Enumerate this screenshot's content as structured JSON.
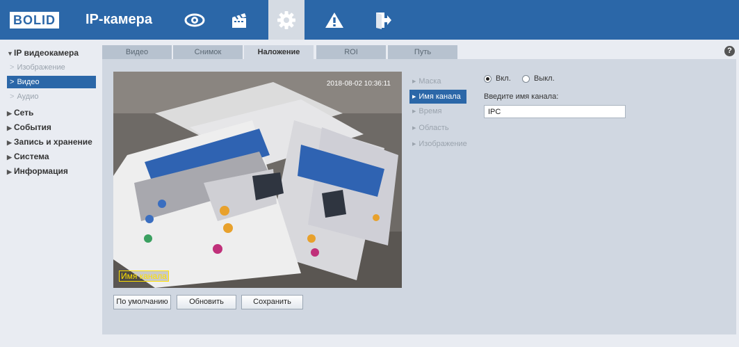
{
  "header": {
    "logo_text": "BOLID",
    "app_title": "IP-камера",
    "nav_icons": [
      "eye-icon",
      "clapperboard-icon",
      "gear-icon",
      "warning-icon",
      "logout-icon"
    ],
    "active_icon": "gear-icon",
    "brand_color": "#2b67a8"
  },
  "sidebar": {
    "groups": [
      {
        "label": "IP видеокамера",
        "expanded": true
      },
      {
        "label": "Сеть"
      },
      {
        "label": "События"
      },
      {
        "label": "Запись и хранение"
      },
      {
        "label": "Система"
      },
      {
        "label": "Информация"
      }
    ],
    "subitems": [
      {
        "label": "Изображение"
      },
      {
        "label": "Видео",
        "active": true
      },
      {
        "label": "Аудио"
      }
    ]
  },
  "tabs": [
    {
      "label": "Видео"
    },
    {
      "label": "Снимок"
    },
    {
      "label": "Наложение",
      "active": true
    },
    {
      "label": "ROI"
    },
    {
      "label": "Путь"
    }
  ],
  "video": {
    "timestamp": "2018-08-02 10:36:11",
    "channel_overlay": "Имя канала"
  },
  "overlay_menu": [
    {
      "label": "Маска"
    },
    {
      "label": "Имя канала",
      "active": true
    },
    {
      "label": "Время"
    },
    {
      "label": "Область"
    },
    {
      "label": "Изображение"
    }
  ],
  "settings": {
    "on_label": "Вкл.",
    "off_label": "Выкл.",
    "selected": "on",
    "channel_name_label": "Введите имя канала:",
    "channel_name_value": "IPC"
  },
  "buttons": {
    "default_label": "По умолчанию",
    "refresh_label": "Обновить",
    "save_label": "Сохранить"
  },
  "help": {
    "symbol": "?"
  }
}
